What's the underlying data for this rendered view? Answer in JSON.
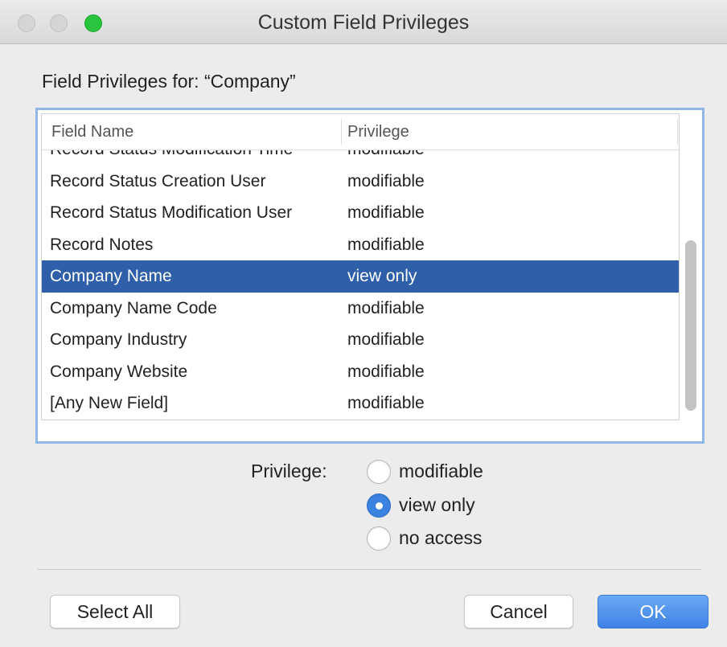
{
  "window": {
    "title": "Custom Field Privileges"
  },
  "heading": "Field Privileges for: “Company”",
  "table": {
    "columns": [
      "Field Name",
      "Privilege"
    ],
    "rows": [
      {
        "field": "Record Status Modification Time",
        "privilege": "modifiable"
      },
      {
        "field": "Record Status Creation User",
        "privilege": "modifiable"
      },
      {
        "field": "Record Status Modification User",
        "privilege": "modifiable"
      },
      {
        "field": "Record Notes",
        "privilege": "modifiable"
      },
      {
        "field": "Company Name",
        "privilege": "view only",
        "selected": true
      },
      {
        "field": "Company Name Code",
        "privilege": "modifiable"
      },
      {
        "field": "Company Industry",
        "privilege": "modifiable"
      },
      {
        "field": "Company Website",
        "privilege": "modifiable"
      },
      {
        "field": "[Any New Field]",
        "privilege": "modifiable"
      }
    ]
  },
  "privilege": {
    "label": "Privilege:",
    "options": [
      "modifiable",
      "view only",
      "no access"
    ],
    "selected": "view only"
  },
  "buttons": {
    "select_all": "Select All",
    "cancel": "Cancel",
    "ok": "OK"
  },
  "colors": {
    "selection": "#2e5fa8",
    "accent": "#3b83e0",
    "focus_ring": "#8fb8e8"
  }
}
